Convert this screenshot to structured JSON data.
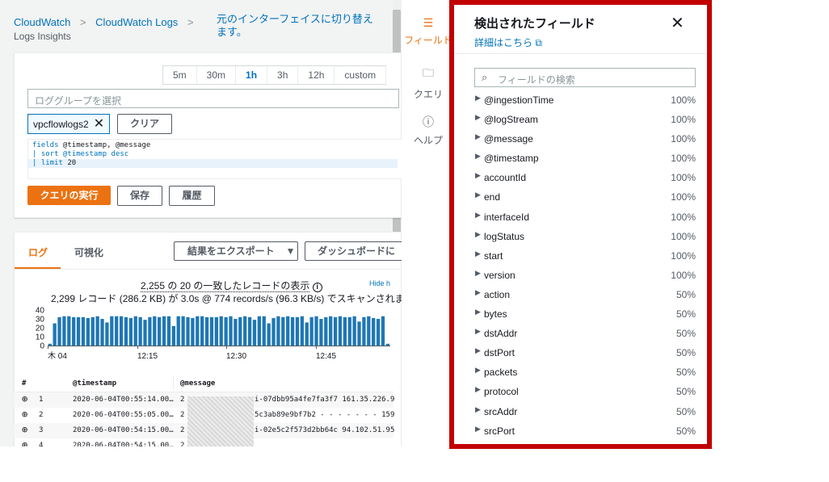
{
  "breadcrumb": {
    "items": [
      "CloudWatch",
      "CloudWatch Logs"
    ],
    "current": "Logs Insights",
    "switch_link": "元のインターフェイスに切り替えます。"
  },
  "time_range": {
    "options": [
      "5m",
      "30m",
      "1h",
      "3h",
      "12h",
      "custom"
    ],
    "selected": "1h"
  },
  "query": {
    "log_group_placeholder": "ロググループを選択",
    "selected_group": "vpcflowlogs2",
    "clear_label": "クリア",
    "lines": [
      [
        "fields",
        " @timestamp, @message"
      ],
      [
        "| sort",
        " @timestamp desc"
      ],
      [
        "| limit",
        " 20"
      ]
    ],
    "run_label": "クエリの実行",
    "save_label": "保存",
    "history_label": "履歴"
  },
  "results": {
    "tabs": [
      "ログ",
      "可視化"
    ],
    "export_label": "結果をエクスポート",
    "dashboard_label": "ダッシュボードに",
    "summary_line1": "2,255 の 20 の一致したレコードの表示",
    "summary_line2": "2,299 レコード (286.2 KB) が 3.0s @ 774 records/s (96.3 KB/s) でスキャンされまし",
    "hide_link": "Hide h",
    "columns": [
      "#",
      "@timestamp",
      "@message"
    ],
    "rows": [
      {
        "n": "1",
        "ts": "2020-06-04T00:55:14.00…",
        "p": "2",
        "msg": "i-07dbb95a4fe7fa3f7 161.35.226.9"
      },
      {
        "n": "2",
        "ts": "2020-06-04T00:55:05.00…",
        "p": "2",
        "msg": "5c3ab89e9bf7b2 - - - - - - - 159"
      },
      {
        "n": "3",
        "ts": "2020-06-04T00:54:15.00…",
        "p": "2",
        "msg": "i-02e5c2f573d2bb64c 94.102.51.95"
      },
      {
        "n": "4",
        "ts": "2020-06-04T00:54:15.00…",
        "p": "2",
        "msg": ""
      }
    ]
  },
  "chart_data": {
    "type": "bar",
    "yticks": [
      0,
      10,
      20,
      30,
      40
    ],
    "ylim": [
      0,
      40
    ],
    "xticks": [
      "木 04",
      "12:15",
      "12:30",
      "12:45"
    ],
    "values": [
      2,
      25,
      32,
      33,
      33,
      32,
      32,
      32,
      31,
      32,
      33,
      30,
      26,
      33,
      33,
      33,
      32,
      31,
      33,
      32,
      29,
      32,
      33,
      32,
      33,
      33,
      22,
      33,
      33,
      32,
      31,
      33,
      33,
      32,
      32,
      32,
      33,
      32,
      33,
      30,
      32,
      33,
      32,
      29,
      33,
      33,
      25,
      31,
      33,
      32,
      33,
      32,
      32,
      33,
      26,
      32,
      33,
      30,
      32,
      33,
      32,
      33,
      32,
      32,
      33,
      27,
      32,
      33,
      31,
      30,
      33,
      2
    ],
    "color": "#1f77b4"
  },
  "sidebar": {
    "items": [
      {
        "icon": "menu-icon",
        "label": "フィールド"
      },
      {
        "icon": "folder-icon",
        "label": "クエリ"
      },
      {
        "icon": "info-icon",
        "label": "ヘルプ"
      }
    ]
  },
  "fields_panel": {
    "title": "検出されたフィールド",
    "learn_more": "詳細はこちら",
    "search_placeholder": "フィールドの検索",
    "fields": [
      {
        "name": "@ingestionTime",
        "pct": "100%"
      },
      {
        "name": "@logStream",
        "pct": "100%"
      },
      {
        "name": "@message",
        "pct": "100%"
      },
      {
        "name": "@timestamp",
        "pct": "100%"
      },
      {
        "name": "accountId",
        "pct": "100%"
      },
      {
        "name": "end",
        "pct": "100%"
      },
      {
        "name": "interfaceId",
        "pct": "100%"
      },
      {
        "name": "logStatus",
        "pct": "100%"
      },
      {
        "name": "start",
        "pct": "100%"
      },
      {
        "name": "version",
        "pct": "100%"
      },
      {
        "name": "action",
        "pct": "50%"
      },
      {
        "name": "bytes",
        "pct": "50%"
      },
      {
        "name": "dstAddr",
        "pct": "50%"
      },
      {
        "name": "dstPort",
        "pct": "50%"
      },
      {
        "name": "packets",
        "pct": "50%"
      },
      {
        "name": "protocol",
        "pct": "50%"
      },
      {
        "name": "srcAddr",
        "pct": "50%"
      },
      {
        "name": "srcPort",
        "pct": "50%"
      }
    ]
  },
  "colors": {
    "accent": "#ec7211",
    "link": "#0073bb",
    "highlight_border": "#c20000"
  }
}
